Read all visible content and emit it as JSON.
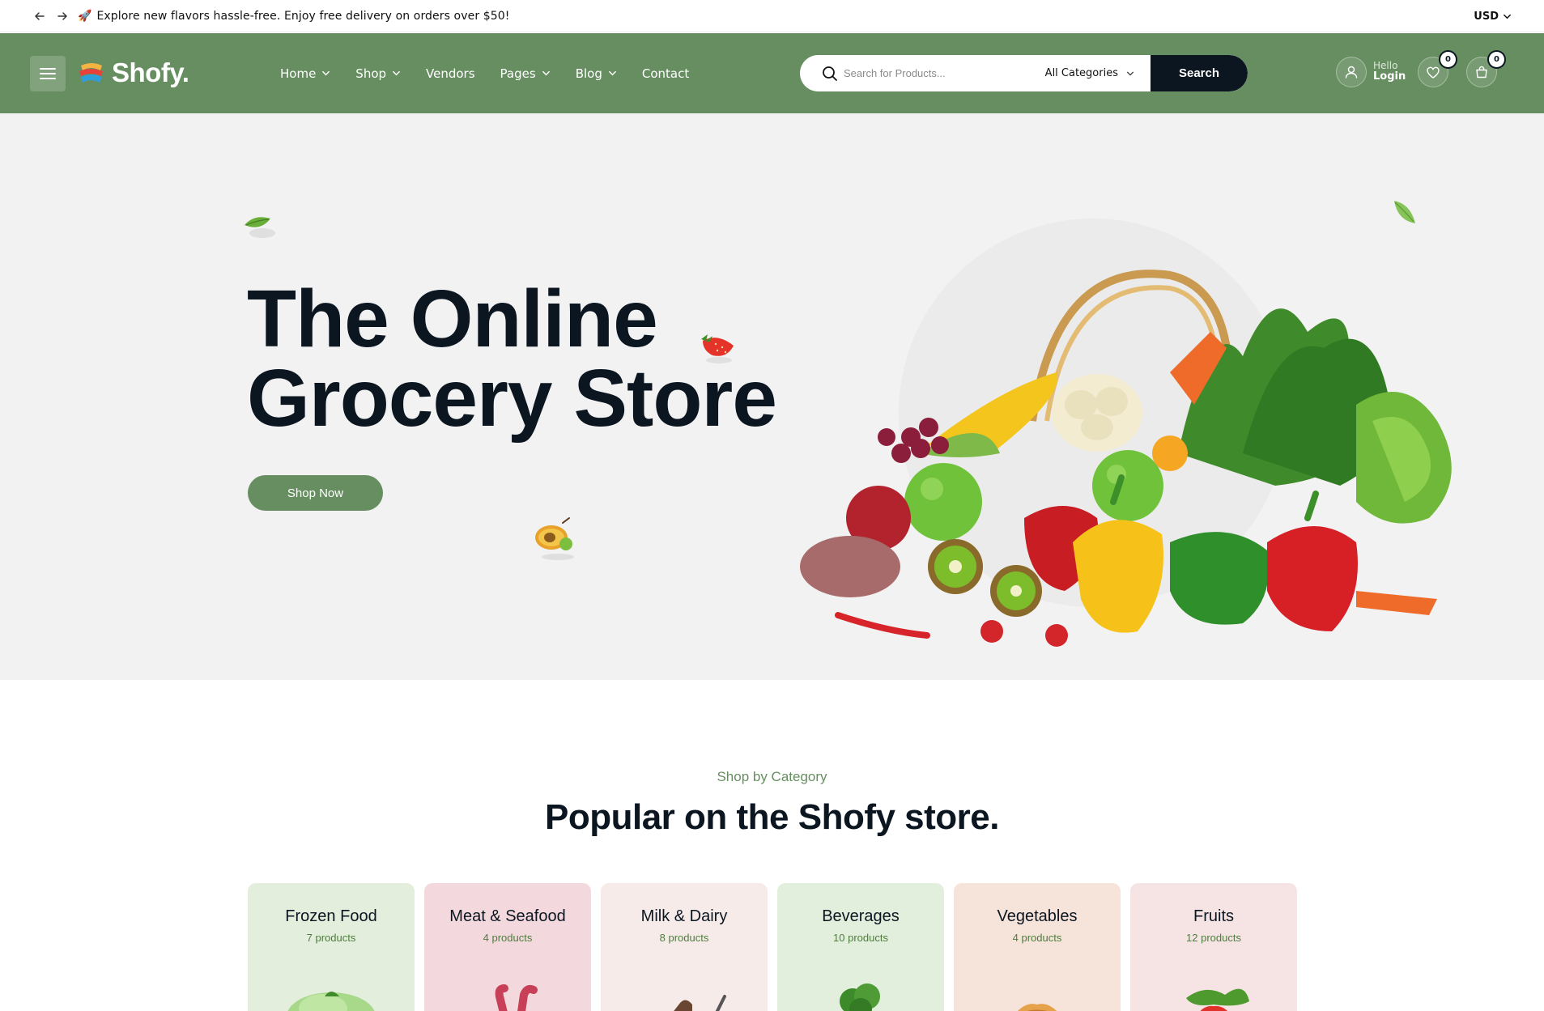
{
  "topbar": {
    "announcement": "Explore new flavors hassle-free. Enjoy free delivery on orders over $50!",
    "currency": "USD"
  },
  "header": {
    "logo_text": "Shofy.",
    "nav": [
      {
        "label": "Home",
        "has_dropdown": true
      },
      {
        "label": "Shop",
        "has_dropdown": true
      },
      {
        "label": "Vendors",
        "has_dropdown": false
      },
      {
        "label": "Pages",
        "has_dropdown": true
      },
      {
        "label": "Blog",
        "has_dropdown": true
      },
      {
        "label": "Contact",
        "has_dropdown": false
      }
    ],
    "search": {
      "placeholder": "Search for Products...",
      "category": "All Categories",
      "button": "Search"
    },
    "account": {
      "greeting": "Hello",
      "action": "Login"
    },
    "wishlist_count": "0",
    "cart_count": "0",
    "colors": {
      "header_bg": "#678e61",
      "search_btn": "#0b1621"
    }
  },
  "hero": {
    "title_line1": "The Online",
    "title_line2": "Grocery Store",
    "cta": "Shop Now"
  },
  "categories": {
    "subtitle": "Shop by Category",
    "title": "Popular on the Shofy store.",
    "items": [
      {
        "name": "Frozen Food",
        "count": "7 products",
        "bg": "#e3efdc",
        "icon": "ice-cream-icon"
      },
      {
        "name": "Meat & Seafood",
        "count": "4 products",
        "bg": "#f3d9dd",
        "icon": "meat-icon"
      },
      {
        "name": "Milk & Dairy",
        "count": "8 products",
        "bg": "#f6ebe9",
        "icon": "dairy-icon"
      },
      {
        "name": "Beverages",
        "count": "10 products",
        "bg": "#e2efdc",
        "icon": "broccoli-icon"
      },
      {
        "name": "Vegetables",
        "count": "4 products",
        "bg": "#f6e3da",
        "icon": "bread-icon"
      },
      {
        "name": "Fruits",
        "count": "12 products",
        "bg": "#f6e4e4",
        "icon": "strawberry-icon"
      }
    ]
  }
}
